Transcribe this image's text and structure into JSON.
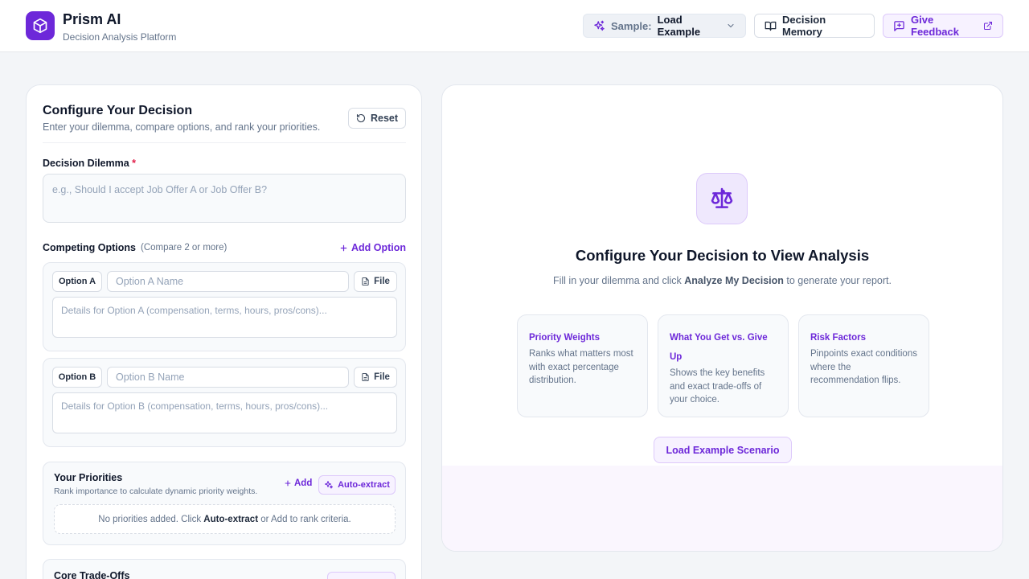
{
  "header": {
    "app_name": "Prism AI",
    "app_subtitle": "Decision Analysis Platform",
    "sample_label": "Sample:",
    "sample_value": "Load Example",
    "memory_label": "Decision Memory",
    "feedback_label": "Give Feedback"
  },
  "config": {
    "title": "Configure Your Decision",
    "subtitle": "Enter your dilemma, compare options, and rank your priorities.",
    "reset_label": "Reset",
    "dilemma_label": "Decision Dilemma",
    "dilemma_required": "*",
    "dilemma_placeholder": "e.g., Should I accept Job Offer A or Job Offer B?",
    "options_label": "Competing Options",
    "options_hint": "(Compare 2 or more)",
    "add_option_label": "Add Option",
    "options": [
      {
        "tag": "Option A",
        "name_placeholder": "Option A Name",
        "file_label": "File",
        "details_placeholder": "Details for Option A (compensation, terms, hours, pros/cons)..."
      },
      {
        "tag": "Option B",
        "name_placeholder": "Option B Name",
        "file_label": "File",
        "details_placeholder": "Details for Option B (compensation, terms, hours, pros/cons)..."
      }
    ],
    "priorities": {
      "title": "Your Priorities",
      "subtitle": "Rank importance to calculate dynamic priority weights.",
      "add_label": "Add",
      "auto_label": "Auto-extract",
      "empty_prefix": "No priorities added. Click ",
      "empty_bold": "Auto-extract",
      "empty_suffix": " or Add to rank criteria."
    },
    "tradeoffs": {
      "title": "Core Trade-Offs"
    }
  },
  "analysis": {
    "title": "Configure Your Decision to View Analysis",
    "sub_prefix": "Fill in your dilemma and click ",
    "sub_bold": "Analyze My Decision",
    "sub_suffix": " to generate your report.",
    "features": [
      {
        "title": "Priority Weights",
        "desc": "Ranks what matters most with exact percentage distribution."
      },
      {
        "title": "What You Get vs. Give Up",
        "desc": "Shows the key benefits and exact trade-offs of your choice."
      },
      {
        "title": "Risk Factors",
        "desc": "Pinpoints exact conditions where the recommendation flips."
      }
    ],
    "load_example_label": "Load Example Scenario"
  },
  "icons": {
    "logo": "cube-icon",
    "sample": "sparkles-icon",
    "memory": "book-open-icon",
    "feedback": "message-plus-icon",
    "analysis": "scale-icon"
  },
  "colors": {
    "brand": "#6d28d9",
    "brand_tint": "#f7f2ff",
    "background": "#f3f5f8",
    "required": "#e11d48"
  }
}
